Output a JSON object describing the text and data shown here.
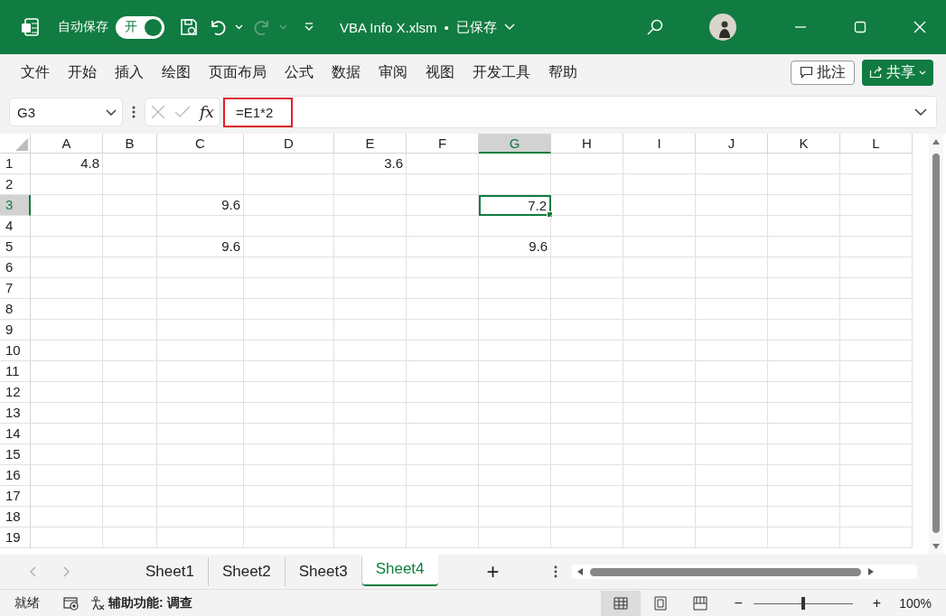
{
  "title_bar": {
    "autosave_label": "自动保存",
    "autosave": {
      "on": true,
      "label": "开"
    },
    "file_name": "VBA Info X.xlsm",
    "separator": "•",
    "save_state": "已保存"
  },
  "menu": [
    {
      "label": "文件"
    },
    {
      "label": "开始"
    },
    {
      "label": "插入"
    },
    {
      "label": "绘图"
    },
    {
      "label": "页面布局"
    },
    {
      "label": "公式"
    },
    {
      "label": "数据"
    },
    {
      "label": "审阅"
    },
    {
      "label": "视图"
    },
    {
      "label": "开发工具"
    },
    {
      "label": "帮助"
    }
  ],
  "comments_button": "批注",
  "share_button": "共享",
  "formula_bar": {
    "name_box": "G3",
    "fx": "fx",
    "formula": "=E1*2",
    "highlighted": true
  },
  "columns": [
    {
      "label": "A",
      "selected": false
    },
    {
      "label": "B",
      "selected": false
    },
    {
      "label": "C",
      "selected": false
    },
    {
      "label": "D",
      "selected": false
    },
    {
      "label": "E",
      "selected": false
    },
    {
      "label": "F",
      "selected": false
    },
    {
      "label": "G",
      "selected": true
    },
    {
      "label": "H",
      "selected": false
    },
    {
      "label": "I",
      "selected": false
    },
    {
      "label": "J",
      "selected": false
    },
    {
      "label": "K",
      "selected": false
    },
    {
      "label": "L",
      "selected": false
    }
  ],
  "rows": [
    {
      "label": "1",
      "selected": false,
      "cells": [
        {
          "value": "4.8"
        },
        {},
        {},
        {},
        {
          "value": "3.6"
        }
      ]
    },
    {
      "label": "2",
      "selected": false
    },
    {
      "label": "3",
      "selected": true,
      "cells": [
        {},
        {},
        {
          "value": "9.6"
        },
        {},
        {},
        {},
        {
          "value": "7.2",
          "selected": true
        }
      ]
    },
    {
      "label": "4",
      "selected": false
    },
    {
      "label": "5",
      "selected": false,
      "cells": [
        {},
        {},
        {
          "value": "9.6"
        },
        {},
        {},
        {},
        {
          "value": "9.6"
        }
      ]
    },
    {
      "label": "6",
      "selected": false
    },
    {
      "label": "7",
      "selected": false
    },
    {
      "label": "8",
      "selected": false
    },
    {
      "label": "9",
      "selected": false
    },
    {
      "label": "10",
      "selected": false
    },
    {
      "label": "11",
      "selected": false
    },
    {
      "label": "12",
      "selected": false
    },
    {
      "label": "13",
      "selected": false
    },
    {
      "label": "14",
      "selected": false
    },
    {
      "label": "15",
      "selected": false
    },
    {
      "label": "16",
      "selected": false
    },
    {
      "label": "17",
      "selected": false
    },
    {
      "label": "18",
      "selected": false
    },
    {
      "label": "19",
      "selected": false
    }
  ],
  "sheet_tabs": [
    {
      "label": "Sheet1",
      "selected": false
    },
    {
      "label": "Sheet2",
      "selected": false
    },
    {
      "label": "Sheet3",
      "selected": false
    },
    {
      "label": "Sheet4",
      "selected": true
    }
  ],
  "add_sheet": "+",
  "status_bar": {
    "ready": "就绪",
    "accessibility": "辅助功能: 调查",
    "zoom": {
      "level": 0.5,
      "minus": "−",
      "plus": "+",
      "reading": "100%"
    }
  }
}
